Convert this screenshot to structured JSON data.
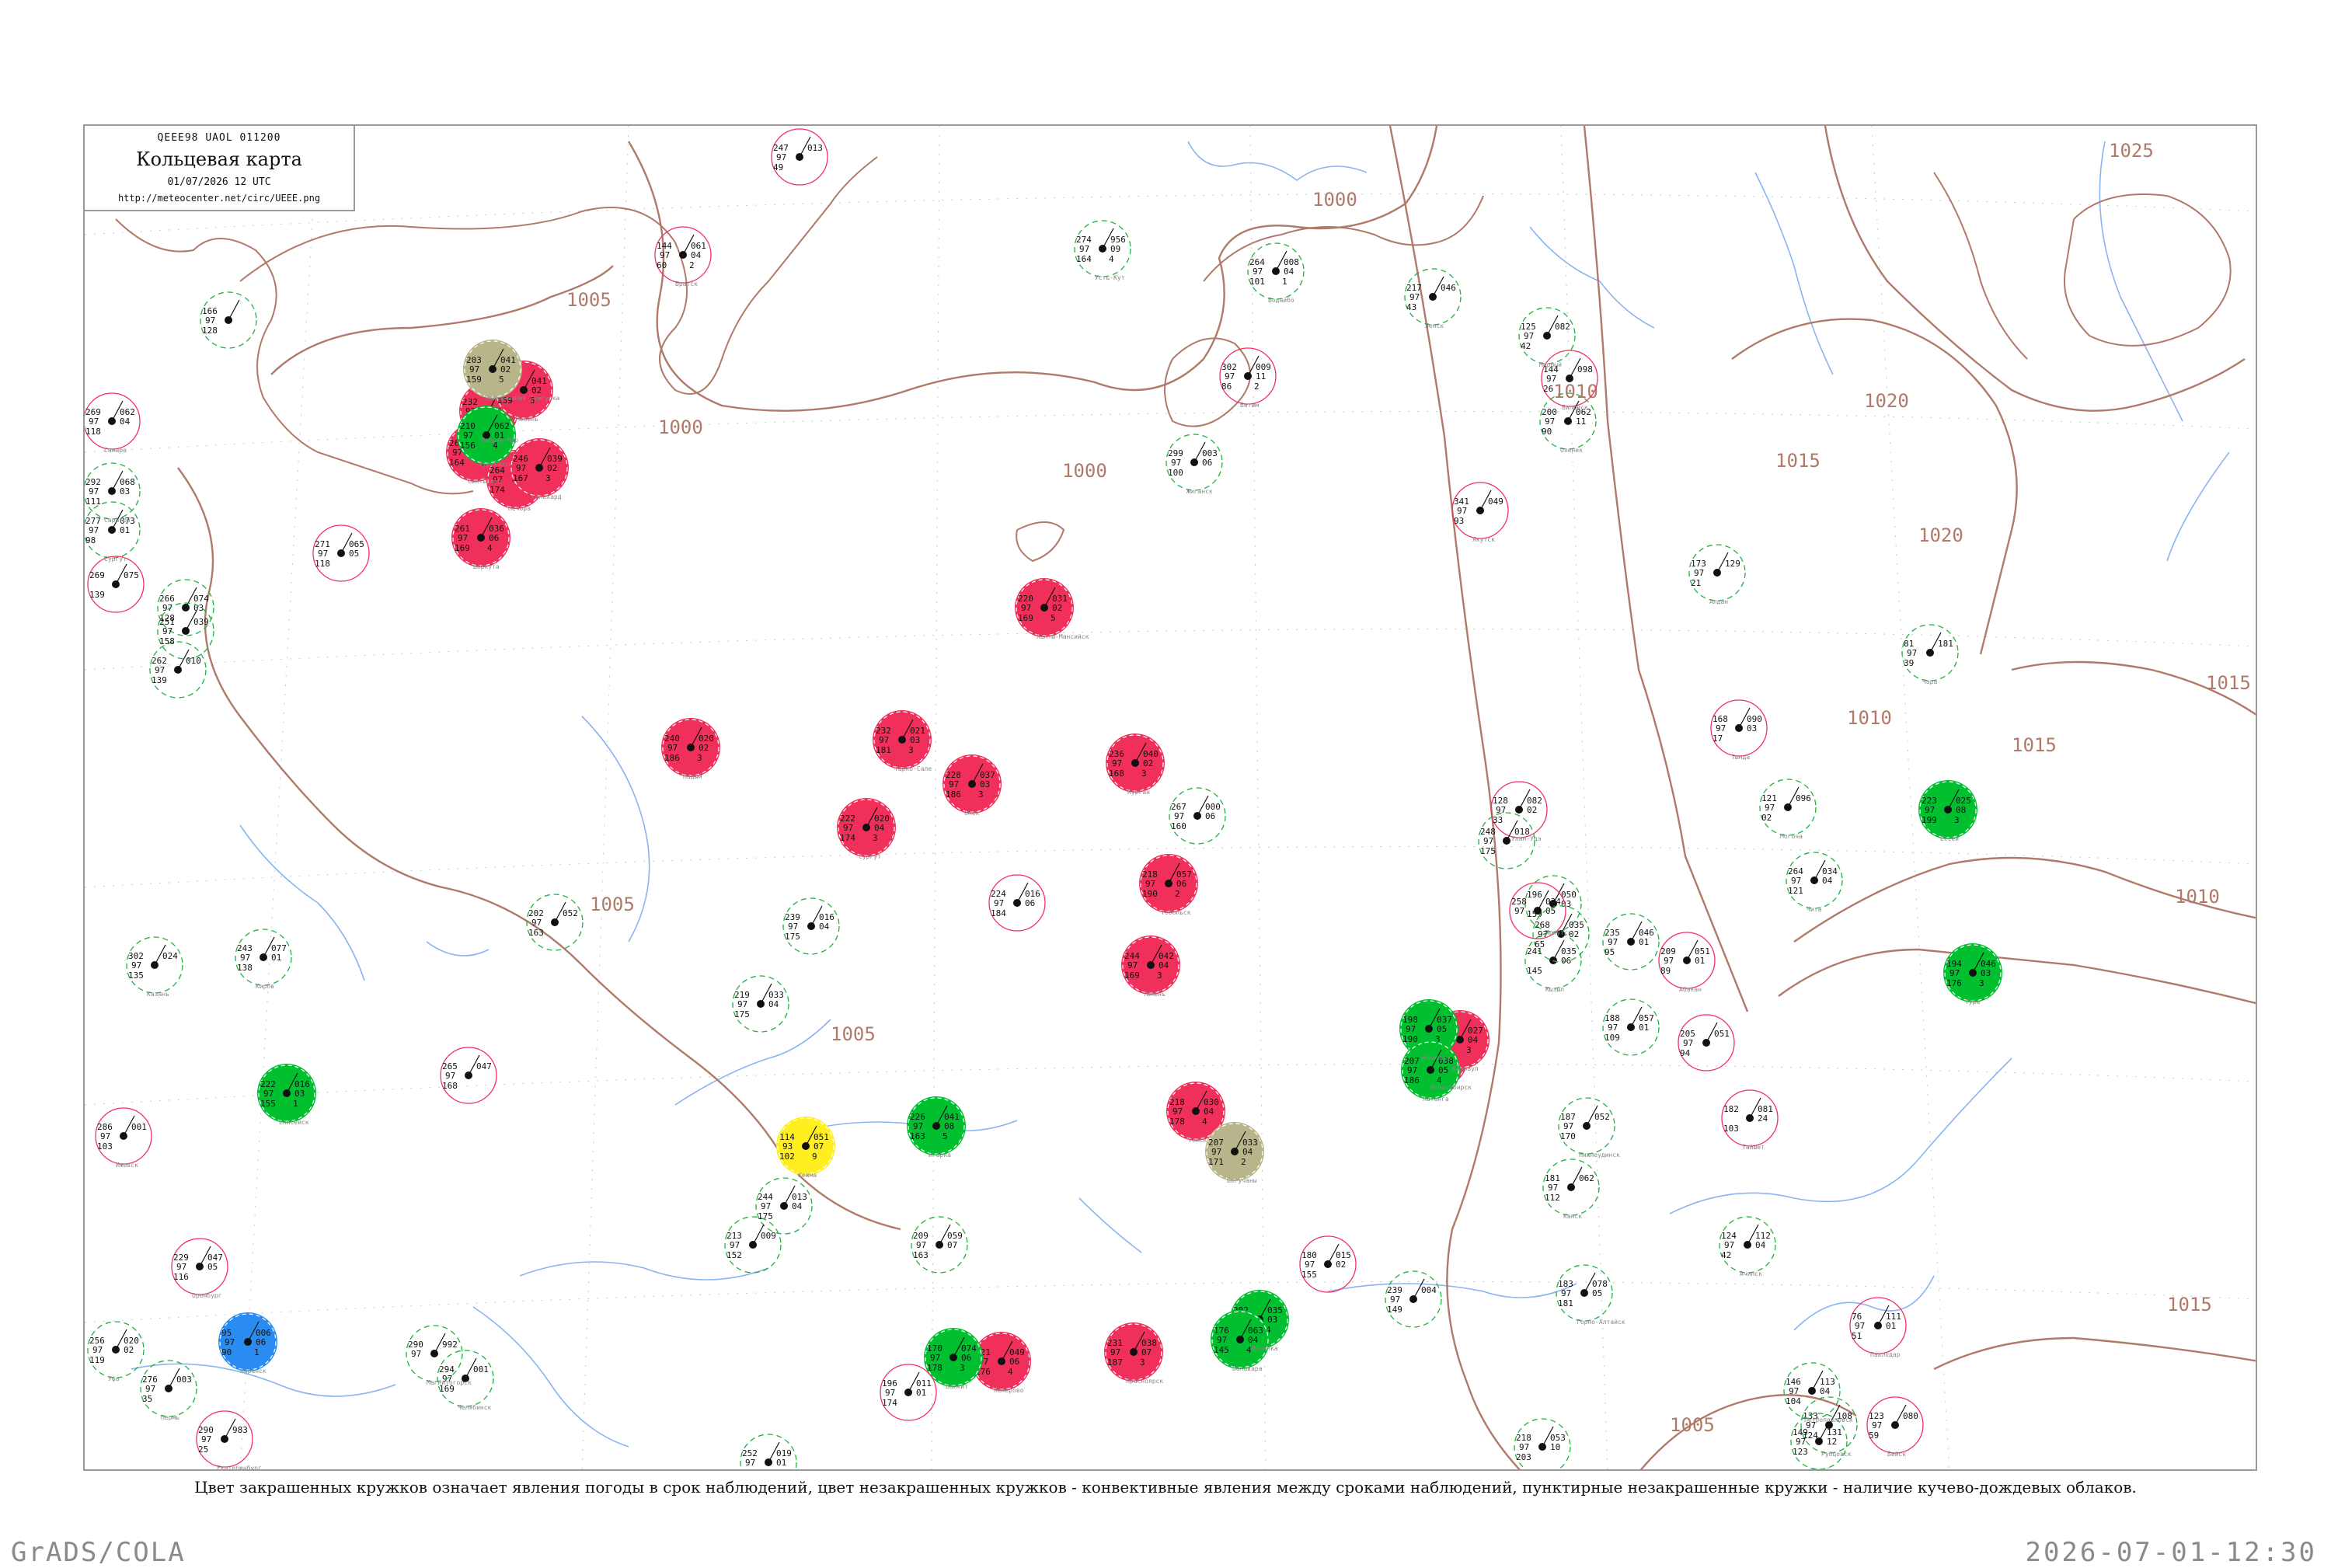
{
  "header": {
    "code": "QEEE98  UAOL  011200",
    "title": "Кольцевая карта",
    "date": "01/07/2026 12 UTC",
    "url": "http://meteocenter.net/circ/UEEE.png"
  },
  "legend_note": "Цвет закрашенных кружков означает явления погоды в срок наблюдений, цвет незакрашенных кружков - конвективные явления между сроками наблюдений, пунктирные незакрашенные кружки - наличие кучево-дождевых облаков.",
  "footer": {
    "left": "GrADS/COLA",
    "right": "2026-07-01-12:30"
  },
  "colors": {
    "isobar": "#b07a6a",
    "river": "#8ab4f0",
    "thunder": "#f0305a",
    "rain": "#00c030",
    "dust": "#b8b58a",
    "fog": "#ffee20",
    "snow": "#2a8cf0",
    "dashed_circle": "#20b040",
    "solid_circle": "#f03060"
  },
  "isobar_labels": [
    "1000",
    "1005",
    "1005",
    "1005",
    "1000",
    "1000",
    "1005",
    "1010",
    "1010",
    "1015",
    "1020",
    "1020",
    "1025",
    "1015",
    "1015",
    "1010",
    "1010",
    "1015",
    "1005"
  ],
  "stations": [
    {
      "cat": "thunder",
      "v": [
        "232",
        "97",
        "157",
        "023",
        "08",
        "1"
      ]
    },
    {
      "cat": "thunder",
      "v": [
        "203",
        "97",
        "159",
        "041",
        "02",
        "5"
      ]
    },
    {
      "cat": "thunder",
      "v": [
        "261",
        "97",
        "164",
        "054",
        "07",
        "3"
      ]
    },
    {
      "cat": "thunder",
      "v": [
        "264",
        "97",
        "174",
        "039",
        "03",
        "3"
      ]
    },
    {
      "cat": "thunder",
      "v": [
        "261",
        "97",
        "169",
        "036",
        "06",
        "4"
      ]
    },
    {
      "cat": "thunder",
      "v": [
        "246",
        "97",
        "167",
        "039",
        "02",
        "3"
      ]
    },
    {
      "cat": "thunder",
      "v": [
        "240",
        "97",
        "186",
        "020",
        "02",
        "3"
      ]
    },
    {
      "cat": "thunder",
      "v": [
        "232",
        "97",
        "181",
        "021",
        "03",
        "3"
      ]
    },
    {
      "cat": "thunder",
      "v": [
        "222",
        "97",
        "174",
        "020",
        "04",
        "3"
      ]
    },
    {
      "cat": "thunder",
      "v": [
        "220",
        "97",
        "169",
        "031",
        "02",
        "5"
      ]
    },
    {
      "cat": "thunder",
      "v": [
        "218",
        "97",
        "190",
        "057",
        "06",
        "2"
      ]
    },
    {
      "cat": "thunder",
      "v": [
        "244",
        "97",
        "169",
        "042",
        "04",
        "3"
      ]
    },
    {
      "cat": "thunder",
      "v": [
        "236",
        "97",
        "168",
        "040",
        "02",
        "3"
      ]
    },
    {
      "cat": "thunder",
      "v": [
        "228",
        "97",
        "186",
        "037",
        "03",
        "3"
      ]
    },
    {
      "cat": "thunder",
      "v": [
        "218",
        "97",
        "178",
        "030",
        "04",
        "4"
      ]
    },
    {
      "cat": "thunder",
      "v": [
        "204",
        "97",
        "188",
        "035",
        "01",
        "3"
      ]
    },
    {
      "cat": "thunder",
      "v": [
        "201",
        "97",
        "183",
        "027",
        "04",
        "3"
      ]
    },
    {
      "cat": "thunder",
      "v": [
        "221",
        "97",
        "176",
        "049",
        "06",
        "4"
      ]
    },
    {
      "cat": "thunder",
      "v": [
        "231",
        "97",
        "187",
        "038",
        "07",
        "3"
      ]
    },
    {
      "cat": "rain",
      "v": [
        "222",
        "97",
        "155",
        "016",
        "03",
        "1"
      ]
    },
    {
      "cat": "rain",
      "v": [
        "210",
        "97",
        "156",
        "062",
        "01",
        "4"
      ]
    },
    {
      "cat": "rain",
      "v": [
        "226",
        "97",
        "163",
        "041",
        "08",
        "5"
      ]
    },
    {
      "cat": "rain",
      "v": [
        "202",
        "97",
        "175",
        "035",
        "03",
        "4"
      ]
    },
    {
      "cat": "rain",
      "v": [
        "198",
        "97",
        "190",
        "037",
        "05",
        "3"
      ]
    },
    {
      "cat": "rain",
      "v": [
        "207",
        "97",
        "186",
        "038",
        "05",
        "4"
      ]
    },
    {
      "cat": "rain",
      "v": [
        "223",
        "97",
        "199",
        "025",
        "08",
        "3"
      ]
    },
    {
      "cat": "rain",
      "v": [
        "194",
        "97",
        "176",
        "046",
        "03",
        "3"
      ]
    },
    {
      "cat": "rain",
      "v": [
        "176",
        "97",
        "145",
        "063",
        "04",
        "4"
      ]
    },
    {
      "cat": "rain",
      "v": [
        "170",
        "97",
        "178",
        "074",
        "06",
        "3"
      ]
    },
    {
      "cat": "dust",
      "v": [
        "203",
        "97",
        "159",
        "041",
        "02",
        "5"
      ]
    },
    {
      "cat": "dust",
      "v": [
        "207",
        "97",
        "171",
        "033",
        "04",
        "2"
      ]
    },
    {
      "cat": "fog",
      "v": [
        "114",
        "93",
        "102",
        "051",
        "07",
        "9"
      ]
    },
    {
      "cat": "snow",
      "v": [
        "95",
        "97",
        "90",
        "006",
        "06",
        "1"
      ]
    },
    {
      "cat": "plain",
      "v": [
        "144",
        "97",
        "60",
        "061",
        "04",
        "2"
      ]
    },
    {
      "cat": "plain",
      "v": [
        "274",
        "97",
        "164",
        "956",
        "09",
        "4"
      ]
    },
    {
      "cat": "plain",
      "v": [
        "264",
        "97",
        "101",
        "008",
        "04",
        "1"
      ]
    },
    {
      "cat": "plain",
      "v": [
        "302",
        "97",
        "86",
        "009",
        "11",
        "2"
      ]
    },
    {
      "cat": "plain",
      "v": [
        "217",
        "97",
        "43",
        "046",
        "",
        ""
      ]
    },
    {
      "cat": "plain",
      "v": [
        "125",
        "97",
        "42",
        "082",
        "",
        ""
      ]
    },
    {
      "cat": "plain",
      "v": [
        "144",
        "97",
        "26",
        "098",
        "",
        ""
      ]
    },
    {
      "cat": "plain",
      "v": [
        "200",
        "97",
        "90",
        "062",
        "11",
        ""
      ]
    },
    {
      "cat": "plain",
      "v": [
        "299",
        "97",
        "100",
        "003",
        "06",
        ""
      ]
    },
    {
      "cat": "plain",
      "v": [
        "341",
        "97",
        "93",
        "049",
        "",
        ""
      ]
    },
    {
      "cat": "plain",
      "v": [
        "173",
        "97",
        "21",
        "129",
        "",
        ""
      ]
    },
    {
      "cat": "plain",
      "v": [
        "81",
        "97",
        "39",
        "181",
        "",
        ""
      ]
    },
    {
      "cat": "plain",
      "v": [
        "168",
        "97",
        "17",
        "090",
        "03",
        ""
      ]
    },
    {
      "cat": "plain",
      "v": [
        "121",
        "97",
        "02",
        "096",
        "",
        ""
      ]
    },
    {
      "cat": "plain",
      "v": [
        "264",
        "97",
        "121",
        "034",
        "04",
        ""
      ]
    },
    {
      "cat": "plain",
      "v": [
        "128",
        "97",
        "33",
        "082",
        "02",
        ""
      ]
    },
    {
      "cat": "plain",
      "v": [
        "196",
        "",
        "159",
        "050",
        "03",
        ""
      ]
    },
    {
      "cat": "plain",
      "v": [
        "187",
        "97",
        "170",
        "052",
        "",
        ""
      ]
    },
    {
      "cat": "plain",
      "v": [
        "182",
        "",
        "103",
        "081",
        "24",
        ""
      ]
    },
    {
      "cat": "plain",
      "v": [
        "181",
        "97",
        "112",
        "062",
        "",
        ""
      ]
    },
    {
      "cat": "plain",
      "v": [
        "124",
        "97",
        "42",
        "112",
        "04",
        ""
      ]
    },
    {
      "cat": "plain",
      "v": [
        "209",
        "97",
        "89",
        "051",
        "01",
        ""
      ]
    },
    {
      "cat": "plain",
      "v": [
        "241",
        "",
        "145",
        "035",
        "06",
        ""
      ]
    },
    {
      "cat": "plain",
      "v": [
        "183",
        "97",
        "181",
        "078",
        "05",
        ""
      ]
    },
    {
      "cat": "plain",
      "v": [
        "123",
        "97",
        "59",
        "080",
        "",
        ""
      ]
    },
    {
      "cat": "plain",
      "v": [
        "133",
        "97",
        "124",
        "108",
        "",
        ""
      ]
    },
    {
      "cat": "plain",
      "v": [
        "149",
        "97",
        "123",
        "131",
        "12",
        ""
      ]
    },
    {
      "cat": "plain",
      "v": [
        "76",
        "97",
        "51",
        "111",
        "01",
        ""
      ]
    },
    {
      "cat": "plain",
      "v": [
        "146",
        "97",
        "104",
        "113",
        "04",
        ""
      ]
    },
    {
      "cat": "plain",
      "v": [
        "218",
        "97",
        "203",
        "053",
        "10",
        ""
      ]
    },
    {
      "cat": "plain",
      "v": [
        "229",
        "97",
        "116",
        "047",
        "05",
        ""
      ]
    },
    {
      "cat": "plain",
      "v": [
        "256",
        "97",
        "119",
        "020",
        "02",
        ""
      ]
    },
    {
      "cat": "plain",
      "v": [
        "276",
        "97",
        "35",
        "003",
        "",
        ""
      ]
    },
    {
      "cat": "plain",
      "v": [
        "290",
        "97",
        "25",
        "983",
        "",
        ""
      ]
    },
    {
      "cat": "plain",
      "v": [
        "294",
        "97",
        "169",
        "001",
        "",
        ""
      ]
    },
    {
      "cat": "plain",
      "v": [
        "290",
        "97",
        "",
        "992",
        "",
        ""
      ]
    },
    {
      "cat": "plain",
      "v": [
        "286",
        "97",
        "103",
        "001",
        "",
        ""
      ]
    },
    {
      "cat": "plain",
      "v": [
        "243",
        "97",
        "138",
        "077",
        "01",
        ""
      ]
    },
    {
      "cat": "plain",
      "v": [
        "302",
        "97",
        "135",
        "024",
        "",
        ""
      ]
    },
    {
      "cat": "plain",
      "v": [
        "269",
        "97",
        "118",
        "062",
        "04",
        ""
      ]
    },
    {
      "cat": "plain",
      "v": [
        "292",
        "97",
        "111",
        "068",
        "03",
        ""
      ]
    },
    {
      "cat": "plain",
      "v": [
        "277",
        "97",
        "98",
        "073",
        "01",
        ""
      ]
    },
    {
      "cat": "plain",
      "v": [
        "269",
        "",
        "139",
        "075",
        "",
        ""
      ]
    },
    {
      "cat": "plain",
      "v": [
        "266",
        "97",
        "128",
        "074",
        "03",
        ""
      ]
    },
    {
      "cat": "plain",
      "v": [
        "262",
        "97",
        "139",
        "010",
        "",
        ""
      ]
    },
    {
      "cat": "plain",
      "v": [
        "271",
        "97",
        "118",
        "065",
        "05",
        ""
      ]
    },
    {
      "cat": "plain",
      "v": [
        "251",
        "97",
        "158",
        "039",
        "",
        ""
      ]
    },
    {
      "cat": "plain",
      "v": [
        "166",
        "97",
        "128",
        "",
        "",
        ""
      ]
    },
    {
      "cat": "plain",
      "v": [
        "247",
        "97",
        "49",
        "013",
        "",
        ""
      ]
    },
    {
      "cat": "plain",
      "v": [
        "239",
        "97",
        "175",
        "016",
        "04",
        ""
      ]
    },
    {
      "cat": "plain",
      "v": [
        "219",
        "97",
        "175",
        "033",
        "04",
        ""
      ]
    },
    {
      "cat": "plain",
      "v": [
        "224",
        "97",
        "184",
        "016",
        "06",
        ""
      ]
    },
    {
      "cat": "plain",
      "v": [
        "267",
        "97",
        "160",
        "000",
        "06",
        ""
      ]
    },
    {
      "cat": "plain",
      "v": [
        "248",
        "97",
        "175",
        "018",
        "",
        ""
      ]
    },
    {
      "cat": "plain",
      "v": [
        "258",
        "97",
        "",
        "034",
        "05",
        ""
      ]
    },
    {
      "cat": "plain",
      "v": [
        "268",
        "97",
        "65",
        "035",
        "02",
        ""
      ]
    },
    {
      "cat": "plain",
      "v": [
        "235",
        "97",
        "95",
        "046",
        "01",
        ""
      ]
    },
    {
      "cat": "plain",
      "v": [
        "205",
        "97",
        "94",
        "051",
        "",
        ""
      ]
    },
    {
      "cat": "plain",
      "v": [
        "188",
        "97",
        "109",
        "057",
        "01",
        ""
      ]
    },
    {
      "cat": "plain",
      "v": [
        "209",
        "97",
        "163",
        "059",
        "07",
        ""
      ]
    },
    {
      "cat": "plain",
      "v": [
        "180",
        "97",
        "155",
        "015",
        "02",
        ""
      ]
    },
    {
      "cat": "plain",
      "v": [
        "244",
        "97",
        "175",
        "013",
        "04",
        ""
      ]
    },
    {
      "cat": "plain",
      "v": [
        "239",
        "97",
        "149",
        "004",
        "",
        ""
      ]
    },
    {
      "cat": "plain",
      "v": [
        "196",
        "97",
        "174",
        "011",
        "01",
        ""
      ]
    },
    {
      "cat": "plain",
      "v": [
        "252",
        "97",
        "143",
        "019",
        "01",
        ""
      ]
    },
    {
      "cat": "plain",
      "v": [
        "202",
        "97",
        "163",
        "052",
        "",
        ""
      ]
    },
    {
      "cat": "plain",
      "v": [
        "265",
        "97",
        "168",
        "047",
        "",
        ""
      ]
    },
    {
      "cat": "plain",
      "v": [
        "213",
        "97",
        "152",
        "009",
        "",
        ""
      ]
    }
  ],
  "station_names": [
    "Нарьян-Мар",
    "Мезень",
    "Сыктывкар",
    "Печора",
    "Воркута",
    "Салехард",
    "Надым",
    "Тарко-Сале",
    "Сургут",
    "Ханты-Мансийск",
    "Тобольск",
    "Тюмень",
    "Курган",
    "Омск",
    "Томск",
    "Новосибирск",
    "Барнаул",
    "Кемерово",
    "Красноярск",
    "Енисейск",
    "Туруханск",
    "Игарка",
    "Дудинка",
    "Норильск",
    "Хатанга",
    "Ессей",
    "Тура",
    "Ванавара",
    "Байкит",
    "Подкаменная Тунгуска",
    "Богучаны",
    "Кежма",
    "Киренск",
    "Братск",
    "Усть-Кут",
    "Бодайбо",
    "Витим",
    "Ленск",
    "Мирный",
    "Вилюйск",
    "Оленек",
    "Жиганск",
    "Якутск",
    "Алдан",
    "Чара",
    "Тында",
    "Могоча",
    "Чита",
    "Улан-Удэ",
    "Иркутск",
    "Нижнеудинск",
    "Тайшет",
    "Канск",
    "Ачинск",
    "Абакан",
    "Кызыл",
    "Горно-Алтайск",
    "Бийск",
    "Рубцовск",
    "Семей",
    "Павлодар",
    "Петропавловск",
    "Костанай",
    "Оренбург",
    "Уфа",
    "Пермь",
    "Екатеринбург",
    "Челябинск",
    "Магнитогорск",
    "Ижевск",
    "Киров",
    "Казань",
    "Самара",
    "Саратов",
    "Сургут"
  ]
}
